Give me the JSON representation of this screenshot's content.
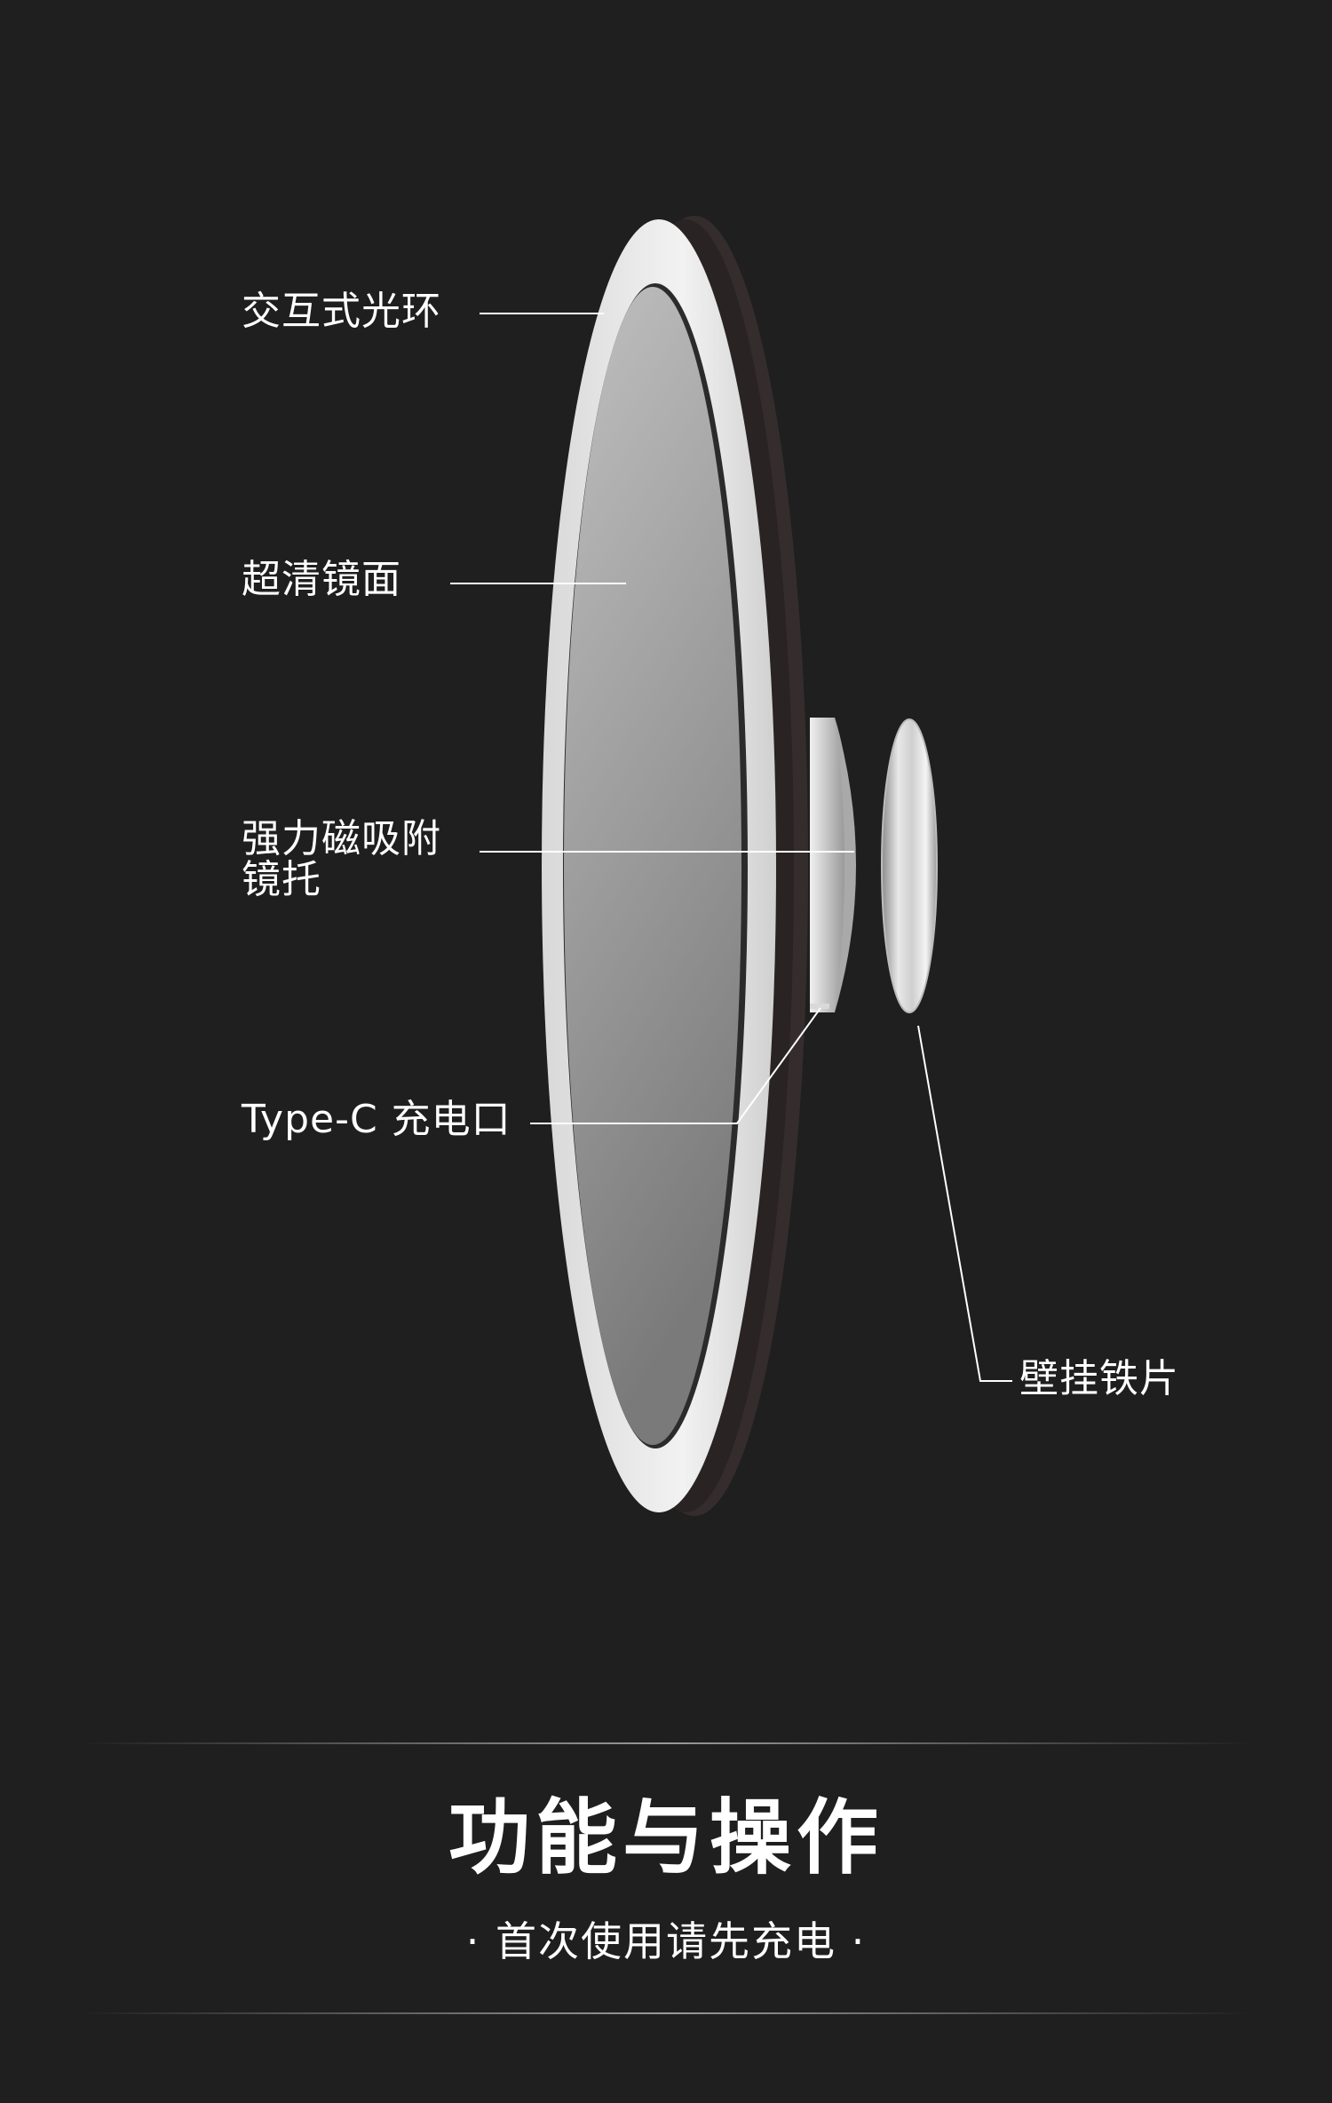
{
  "labels": {
    "ring": "交互式光环",
    "mirror": "超清镜面",
    "holder_line1": "强力磁吸附",
    "holder_line2": "镜托",
    "port": "Type-C 充电口",
    "plate": "壁挂铁片"
  },
  "section": {
    "title": "功能与操作",
    "subtitle": "· 首次使用请先充电 ·"
  },
  "colors": {
    "background": "#1f1f1f",
    "text": "#ffffff",
    "ring": "#e6e6e6",
    "mirror_top": "#b5b5b5",
    "mirror_bottom": "#7e7e7e",
    "shell": "#3a3232"
  }
}
